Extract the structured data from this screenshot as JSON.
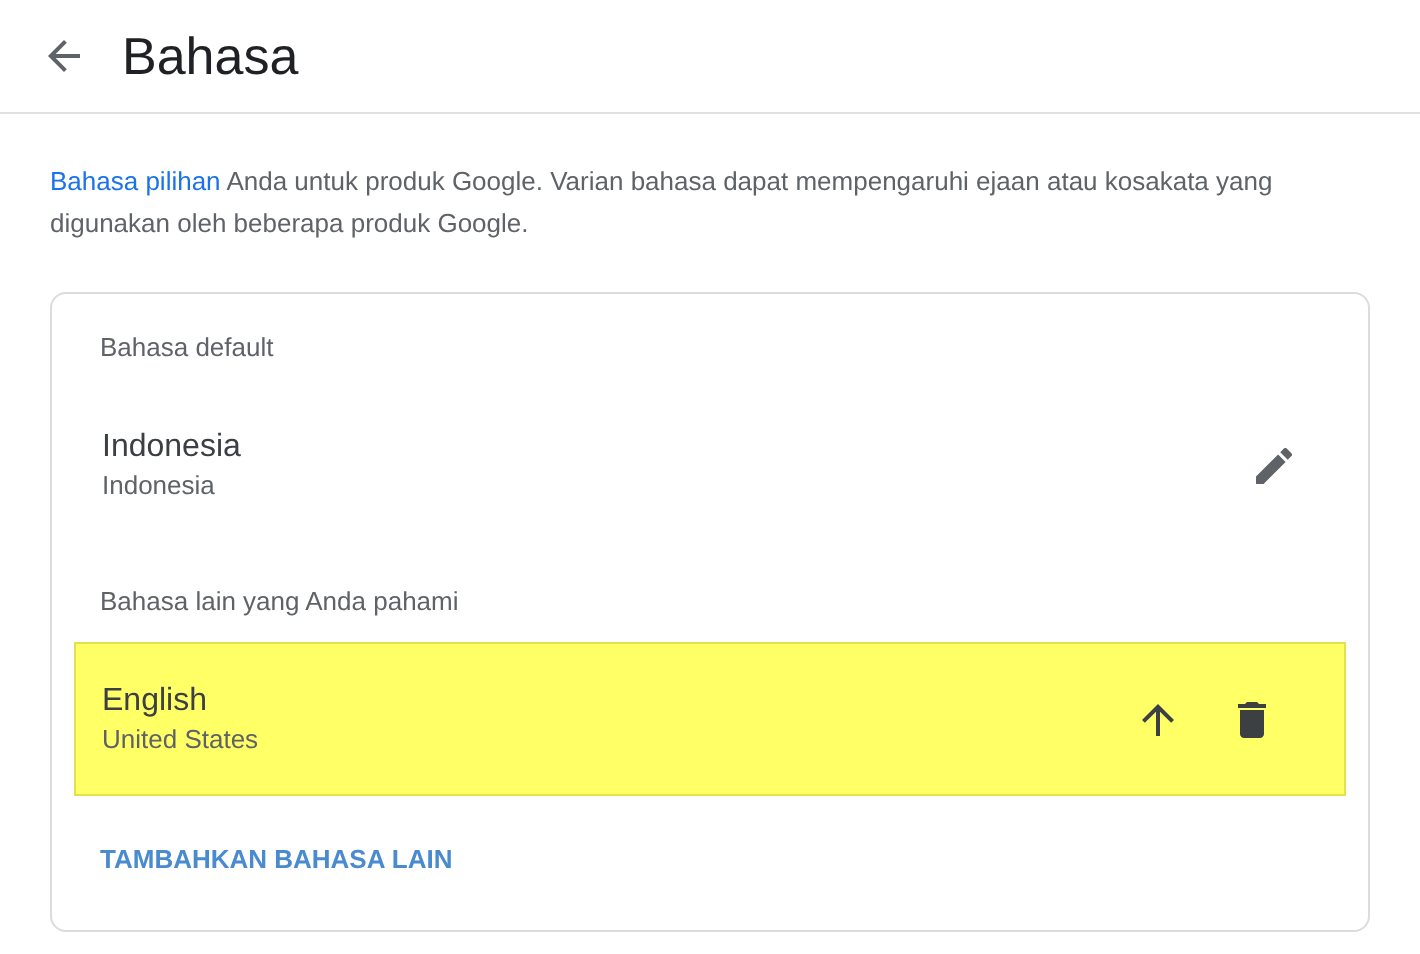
{
  "header": {
    "title": "Bahasa"
  },
  "intro": {
    "link": "Bahasa pilihan",
    "text": "Anda untuk produk Google. Varian bahasa dapat mempengaruhi ejaan atau kosakata yang digunakan oleh beberapa produk Google."
  },
  "sections": [
    {
      "label": "Bahasa default",
      "languages": [
        {
          "kind": "default",
          "name": "Indonesia",
          "region": "Indonesia",
          "highlighted": false
        }
      ]
    },
    {
      "label": "Bahasa lain yang Anda pahami",
      "languages": [
        {
          "kind": "other",
          "name": "English",
          "region": "United States",
          "highlighted": true
        }
      ]
    }
  ],
  "add_button": "TAMBAHKAN BAHASA LAIN"
}
